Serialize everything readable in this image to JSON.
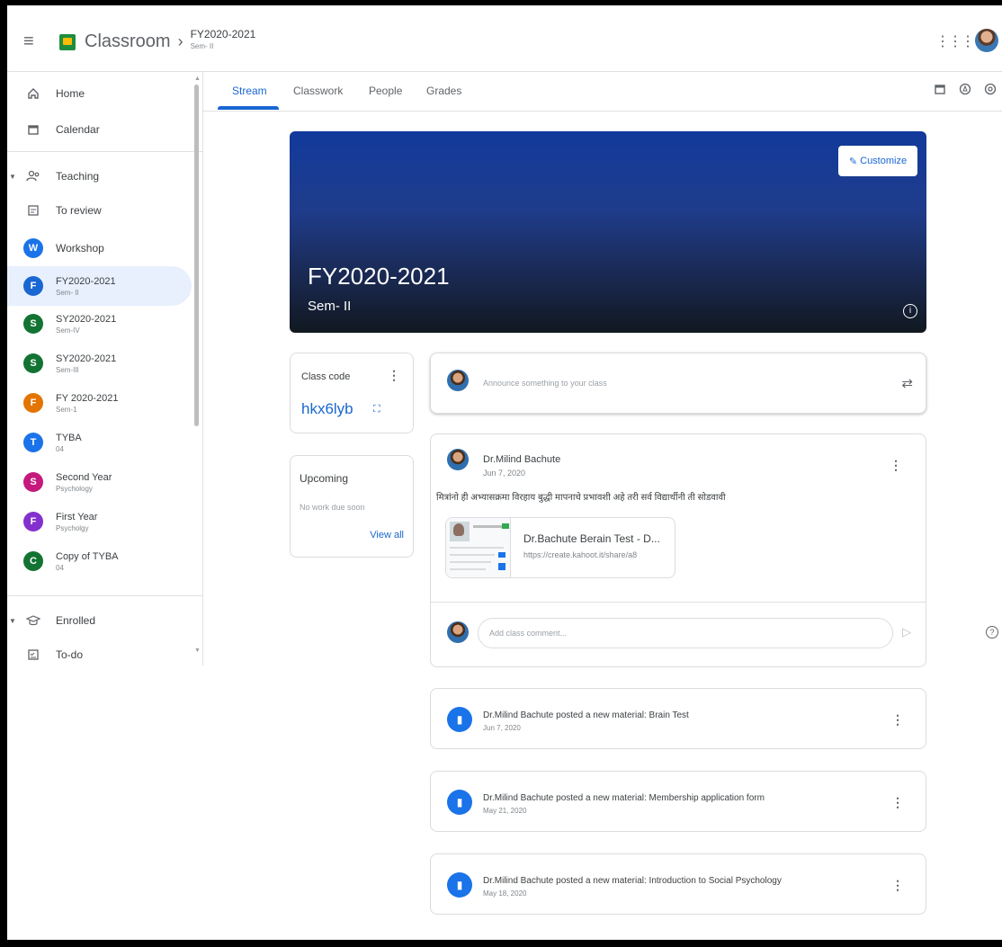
{
  "header": {
    "app_title": "Classroom",
    "crumb_sep": "›",
    "class_name": "FY2020-2021",
    "class_section": "Sem- II"
  },
  "sidebar": {
    "home": "Home",
    "calendar": "Calendar",
    "teaching": "Teaching",
    "to_review": "To review",
    "classes": [
      {
        "initial": "W",
        "name": "Workshop",
        "section": "",
        "color": "#1a73e8"
      },
      {
        "initial": "F",
        "name": "FY2020-2021",
        "section": "Sem- II",
        "color": "#1967d2"
      },
      {
        "initial": "S",
        "name": "SY2020-2021",
        "section": "Sem-IV",
        "color": "#137333"
      },
      {
        "initial": "S",
        "name": "SY2020-2021",
        "section": "Sem-III",
        "color": "#137333"
      },
      {
        "initial": "F",
        "name": "FY 2020-2021",
        "section": "Sem-1",
        "color": "#e37400"
      },
      {
        "initial": "T",
        "name": "TYBA",
        "section": "04",
        "color": "#1a73e8"
      },
      {
        "initial": "S",
        "name": "Second Year",
        "section": "Psychology",
        "color": "#c5197d"
      },
      {
        "initial": "F",
        "name": "First Year",
        "section": "Psycholgy",
        "color": "#8430ce"
      },
      {
        "initial": "C",
        "name": "Copy of TYBA",
        "section": "04",
        "color": "#137333"
      }
    ],
    "enrolled": "Enrolled",
    "todo": "To-do"
  },
  "tabs": [
    "Stream",
    "Classwork",
    "People",
    "Grades"
  ],
  "banner": {
    "customize": "Customize",
    "title": "FY2020-2021",
    "subtitle": "Sem- II"
  },
  "class_code": {
    "label": "Class code",
    "value": "hkx6lyb"
  },
  "upcoming": {
    "label": "Upcoming",
    "empty": "No work due soon",
    "view_all": "View all"
  },
  "announce": {
    "placeholder": "Announce something to your class"
  },
  "post": {
    "author": "Dr.Milind Bachute",
    "date": "Jun 7, 2020",
    "body": "मित्रांनो ही अभ्यासक्रमा विरहाय बुद्धी मापनाचे प्रभावशी अहे तरी सर्व विद्यार्थीनी ती सोडवावी",
    "attachment_title": "Dr.Bachute Berain Test - D...",
    "attachment_url": "https://create.kahoot.it/share/a8",
    "comment_placeholder": "Add class comment..."
  },
  "materials": [
    {
      "title": "Dr.Milind Bachute posted a new material: Brain Test",
      "date": "Jun 7, 2020"
    },
    {
      "title": "Dr.Milind Bachute posted a new material: Membership application form",
      "date": "May 21, 2020"
    },
    {
      "title": "Dr.Milind Bachute posted a new material: Introduction to Social Psychology",
      "date": "May 18, 2020"
    }
  ]
}
